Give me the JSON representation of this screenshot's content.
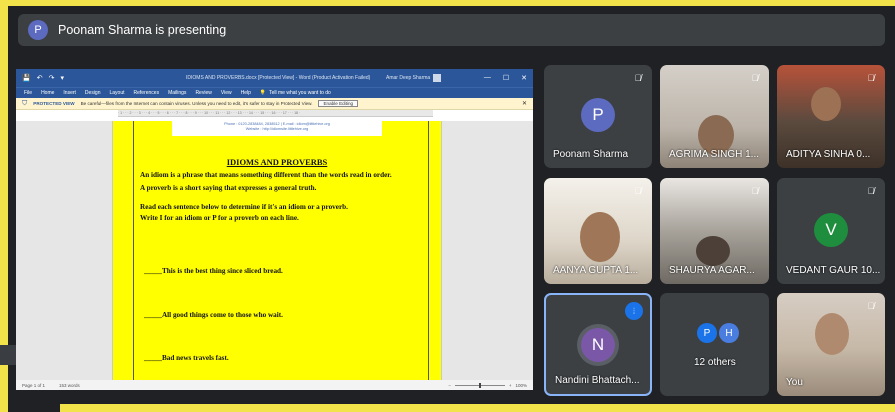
{
  "banner": {
    "avatar_letter": "P",
    "text": "Poonam Sharma is presenting"
  },
  "word": {
    "quick_access": [
      "💾",
      "↶",
      "↷",
      "▾"
    ],
    "title": "IDIOMS AND PROVERBS.docx [Protected View] - Word (Product Activation Failed)",
    "user": "Amar Deep Sharma",
    "window_controls": [
      "—",
      "☐",
      "✕"
    ],
    "ribbon_tabs": [
      "File",
      "Home",
      "Insert",
      "Design",
      "Layout",
      "References",
      "Mailings",
      "Review",
      "View",
      "Help"
    ],
    "tell_me": "Tell me what you want to do",
    "protected_label": "PROTECTED VIEW",
    "protected_msg": "Be careful—files from the Internet can contain viruses. Unless you need to edit, it's safer to stay in Protected View.",
    "enable_editing": "Enable Editing",
    "ruler_marks": "· 1 · · · 2 · · · 3 · · · 4 · · · 5 · · · 6 · · · 7 · · · 8 · · · 9 · · · 10 · · · 11 · · · 12 · · · 13 · · · 14 · · · 15 · · · 16 · · · 17 · · · 18 ·",
    "header_line1": "Phone : 0120-2838484, 2838512 | E-mail : idiom@littlehive.org",
    "header_line2": "Website : http://idiomsite.littlehive.org",
    "doc_title": "IDIOMS AND PROVERBS",
    "lines": [
      "An idiom is a phrase that means something different than the words read in order.",
      "A proverb is a short saying that expresses a general truth.",
      "Read each sentence below to determine if it's an idiom or a proverb.",
      "Write I for an idiom or P for a proverb on each line.",
      "_____This is the best thing since sliced bread.",
      "_____All good things come to those who wait.",
      "_____Bad news travels fast."
    ],
    "status_page": "Page 1 of 1",
    "status_words": "153 words",
    "zoom": "100%"
  },
  "participants": [
    {
      "name": "Poonam Sharma",
      "avatar": "P",
      "avatar_color": "#5c6bc0",
      "muted": true
    },
    {
      "name": "AGRIMA SINGH 1...",
      "muted": true
    },
    {
      "name": "ADITYA SINHA 0...",
      "muted": true
    },
    {
      "name": "AANYA GUPTA 1...",
      "muted": true
    },
    {
      "name": "SHAURYA AGAR...",
      "muted": true
    },
    {
      "name": "VEDANT GAUR 10...",
      "avatar": "V",
      "avatar_color": "#1e8e3e",
      "muted": true
    },
    {
      "name": "Nandini Bhattach...",
      "avatar": "N",
      "avatar_color": "#7b57a8",
      "speaking": true
    },
    {
      "name": "12 others",
      "avatars": [
        "P",
        "H"
      ],
      "avatar_color": "#1a73e8"
    },
    {
      "name": "You",
      "muted": true
    }
  ],
  "icons": {
    "mic_off": "mic-off-icon",
    "speaking": "speaking-icon"
  }
}
